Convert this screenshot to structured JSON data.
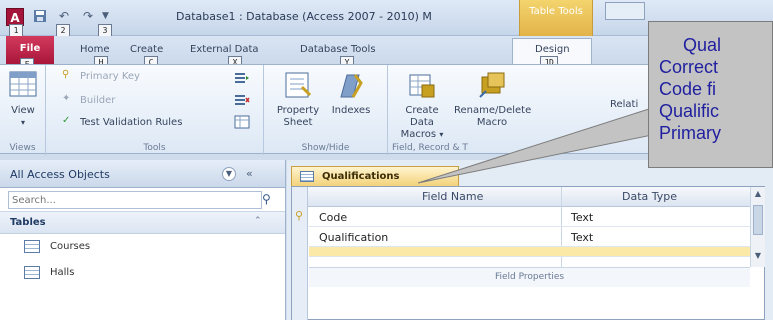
{
  "titlebar": {
    "app_icon": "A",
    "window_title": "Database1 : Database (Access 2007 - 2010) M",
    "context_tab_title": "Table Tools",
    "keytips": {
      "app": "1",
      "qat1": "2",
      "qat2": "3"
    }
  },
  "tabs": {
    "file": "File",
    "home": "Home",
    "create": "Create",
    "external": "External Data",
    "dbtools": "Database Tools",
    "design": "Design",
    "keytips": {
      "file": "F",
      "home": "H",
      "create": "C",
      "external": "X",
      "dbtools": "Y",
      "design": "JD"
    }
  },
  "ribbon": {
    "views": {
      "view_label": "View",
      "group_label": "Views"
    },
    "tools": {
      "primary_key": "Primary Key",
      "builder": "Builder",
      "test_validation": "Test Validation Rules",
      "group_label": "Tools"
    },
    "showhide": {
      "property_sheet": "Property Sheet",
      "indexes": "Indexes",
      "group_label": "Show/Hide"
    },
    "field_events": {
      "create_data_macros": "Create Data Macros",
      "rename_delete_macro": "Rename/Delete Macro",
      "relationships": "Relati",
      "group_label": "Field, Record & T"
    }
  },
  "nav": {
    "title": "All Access Objects",
    "search_placeholder": "Search...",
    "group_label": "Tables",
    "items": [
      "Courses",
      "Halls"
    ]
  },
  "document": {
    "tab_label": "Qualifications",
    "columns": {
      "field_name": "Field Name",
      "data_type": "Data Type"
    },
    "rows": [
      {
        "field_name": "Code",
        "data_type": "Text"
      },
      {
        "field_name": "Qualification",
        "data_type": "Text"
      }
    ],
    "field_properties": "Field Properties"
  },
  "callout": {
    "lines": [
      "Qual",
      "Correct",
      "Code fi",
      "Qualific",
      "Primary"
    ]
  },
  "colors": {
    "accent_red": "#a8163a",
    "context_gold": "#e2b34a",
    "callout_text": "#1f1fa0",
    "callout_bg": "#c3c3c3"
  }
}
